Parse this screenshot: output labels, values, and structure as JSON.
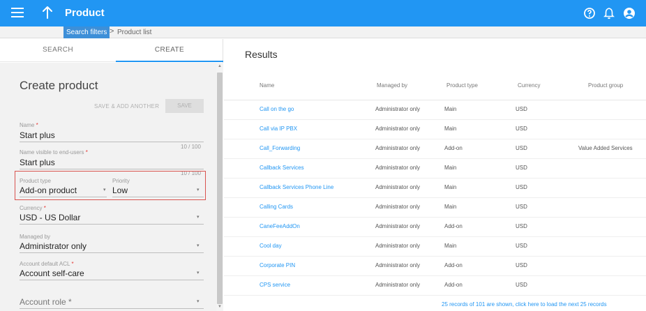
{
  "header": {
    "title": "Product",
    "menu_icon": "menu-icon",
    "back_icon": "arrow-up-icon",
    "help_icon": "help-icon",
    "bell_icon": "bell-icon",
    "user_icon": "account-icon",
    "accent_color": "#2196f3"
  },
  "breadcrumb": {
    "items": [
      "Search filters",
      "Product list"
    ],
    "separator": ">"
  },
  "tabs": {
    "search": "SEARCH",
    "create": "CREATE",
    "active": "CREATE"
  },
  "form": {
    "title": "Create product",
    "save_add_label": "SAVE & ADD ANOTHER",
    "save_label": "SAVE",
    "name": {
      "label": "Name",
      "required": "*",
      "value": "Start plus",
      "counter": "10 / 100"
    },
    "name_visible": {
      "label": "Name visible to end-users",
      "required": "*",
      "value": "Start plus",
      "counter": "10 / 100"
    },
    "product_type": {
      "label": "Product type",
      "value": "Add-on product"
    },
    "priority": {
      "label": "Priority",
      "value": "Low"
    },
    "currency": {
      "label": "Currency",
      "required": "*",
      "value": "USD - US Dollar"
    },
    "managed_by": {
      "label": "Managed by",
      "value": "Administrator only"
    },
    "acl": {
      "label": "Account default ACL",
      "required": "*",
      "value": "Account self-care"
    },
    "account_role": {
      "label": "Account role",
      "required": "*",
      "value": ""
    },
    "dropdown_caret": "▾"
  },
  "results": {
    "title": "Results",
    "columns": [
      "Name",
      "Managed by",
      "Product type",
      "Currency",
      "Product group"
    ],
    "rows": [
      [
        "Call on the go",
        "Administrator only",
        "Main",
        "USD",
        ""
      ],
      [
        "Call via IP PBX",
        "Administrator only",
        "Main",
        "USD",
        ""
      ],
      [
        "Call_Forwarding",
        "Administrator only",
        "Add-on",
        "USD",
        "Value Added Services"
      ],
      [
        "Callback Services",
        "Administrator only",
        "Main",
        "USD",
        ""
      ],
      [
        "Callback Services Phone Line",
        "Administrator only",
        "Main",
        "USD",
        ""
      ],
      [
        "Calling Cards",
        "Administrator only",
        "Main",
        "USD",
        ""
      ],
      [
        "CaneFeeAddOn",
        "Administrator only",
        "Add-on",
        "USD",
        ""
      ],
      [
        "Cool day",
        "Administrator only",
        "Main",
        "USD",
        ""
      ],
      [
        "Corporate PIN",
        "Administrator only",
        "Add-on",
        "USD",
        ""
      ],
      [
        "CPS service",
        "Administrator only",
        "Add-on",
        "USD",
        ""
      ]
    ],
    "footer": "25 records of 101 are shown, click here to load the next 25 records"
  }
}
